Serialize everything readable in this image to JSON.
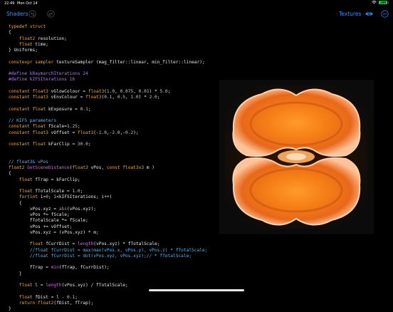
{
  "status_bar": {
    "time": "22:49",
    "date": "Mon Oct 14",
    "battery": "100"
  },
  "navbar": {
    "back_label": "Shaders",
    "textures_label": "Textures",
    "undo_icon": "undo-icon",
    "redo_icon": "redo-icon",
    "preview_toggle_icon": "eye-icon",
    "menu_icon": "ellipsis-icon",
    "accent_color": "#3d8ef7"
  },
  "editor": {
    "language": "Metal",
    "lines": [
      "typedef struct",
      "{",
      "    float2 resolution;",
      "    float time;",
      "} Uniforms;",
      "",
      "constexpr sampler textureSampler (mag_filter::linear, min_filter::linear);",
      "",
      "#define kRaymarchIterations 24",
      "#define kIFSIterations 16",
      "",
      "constant float3 vGlowColour = float3(1.0, 0.075, 0.01) * 5.0;",
      "constant float3 vEnvColour = float3(0.1, 0.5, 1.0) * 2.0;",
      "",
      "constant float kExposure = 0.1;",
      "",
      "// KIFS parameters",
      "constant float fScale=1.25;",
      "constant float3 vOffset = float3(-1.0,-2.0,-0.2);",
      "",
      "constant float kFarClip = 30.0;",
      "",
      "",
      "// float3& vPos",
      "float2 GetSceneDistance(float3 vPos, const float3x3 m )",
      "{",
      "    float fTrap = kFarClip;",
      "",
      "    float fTotalScale = 1.0;",
      "    for(int i=0; i<kIFSIterations; i++)",
      "    {",
      "        vPos.xyz = abs(vPos.xyz);",
      "        vPos *= fScale;",
      "        fTotalScale *= fScale;",
      "        vPos += vOffset;",
      "        vPos.xyz = (vPos.xyz) * m;",
      "",
      "        float fCurrDist = length(vPos.xyz) * fTotalScale;",
      "        //float fCurrDist = max(max(vPos.x, vPos.y), vPos.z) * fTotalScale;",
      "        //float fCurrDist = dot(vPos.xyz, vPos.xyz);// * fTotalScale;",
      "",
      "        fTrap = min(fTrap, fCurrDist);",
      "    }",
      "",
      "    float l = length(vPos.xyz) / fTotalScale;",
      "",
      "    float fDist = l - 0.1;",
      "    return float2(fDist, fTrap);",
      "}"
    ]
  },
  "preview": {
    "name": "shader-render-preview",
    "glow_color": "#ff8c1a"
  }
}
